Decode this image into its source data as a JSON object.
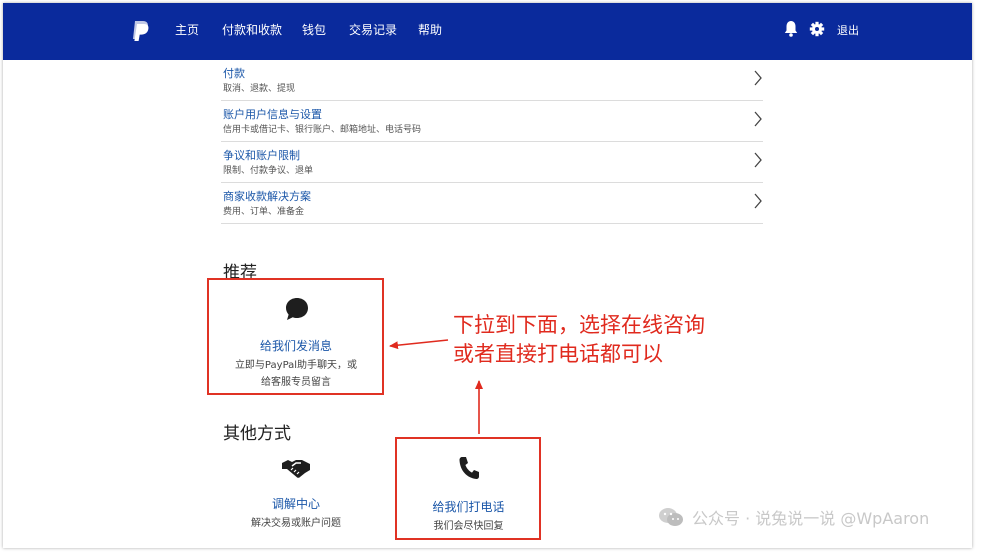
{
  "nav": {
    "items": [
      "主页",
      "付款和收款",
      "钱包",
      "交易记录",
      "帮助"
    ],
    "logout": "退出"
  },
  "menu": [
    {
      "title": "付款",
      "subtitle": "取消、退款、提现"
    },
    {
      "title": "账户用户信息与设置",
      "subtitle": "信用卡或借记卡、银行账户、邮箱地址、电话号码"
    },
    {
      "title": "争议和账户限制",
      "subtitle": "限制、付款争议、退单"
    },
    {
      "title": "商家收款解决方案",
      "subtitle": "费用、订单、准备金"
    }
  ],
  "recommended": {
    "heading": "推荐",
    "message_card": {
      "link": "给我们发消息",
      "desc_line1": "立即与PayPal助手聊天，或",
      "desc_line2": "给客服专员留言"
    }
  },
  "other": {
    "heading": "其他方式",
    "resolution_card": {
      "link": "调解中心",
      "desc": "解决交易或账户问题"
    },
    "phone_card": {
      "link": "给我们打电话",
      "desc": "我们会尽快回复"
    }
  },
  "annotation": {
    "line1": "下拉到下面，选择在线咨询",
    "line2": "或者直接打电话都可以"
  },
  "watermark": {
    "text": "公众号 · 说兔说一说 @WpAaron"
  },
  "colors": {
    "nav_bg": "#0a2a9c",
    "link": "#1a56a8",
    "annotation_red": "#e02a1e"
  }
}
